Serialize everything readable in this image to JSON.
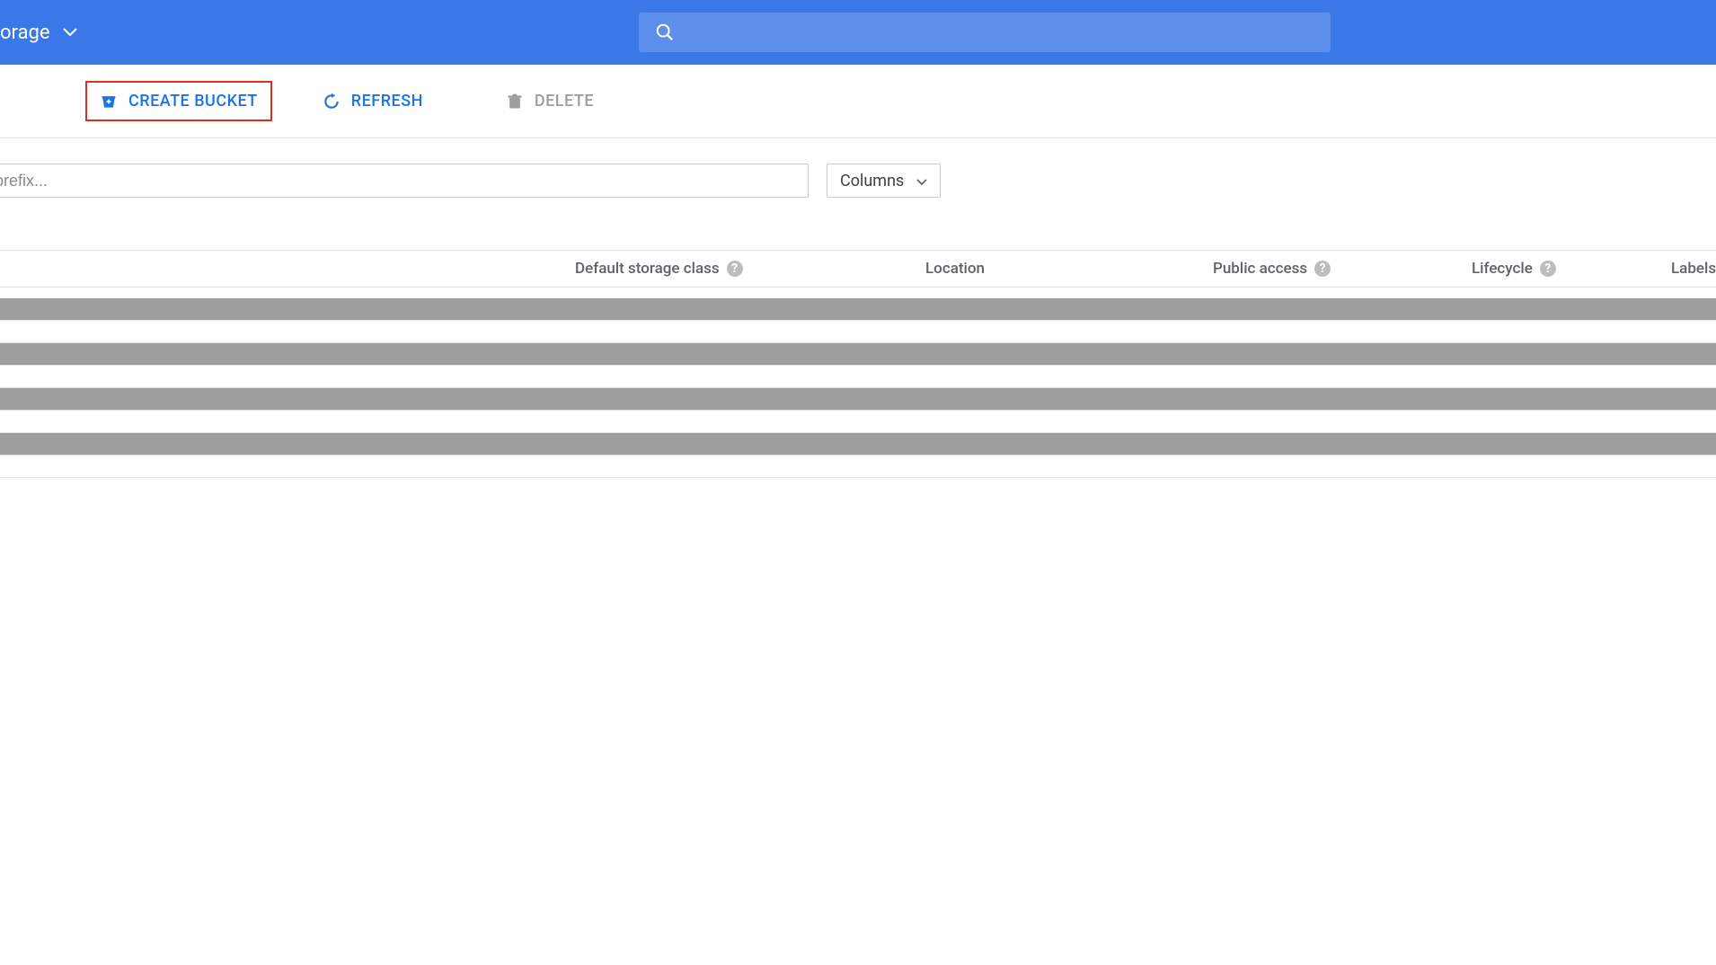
{
  "header": {
    "product_label_suffix": "orage",
    "search_placeholder": ""
  },
  "toolbar": {
    "create_bucket_label": "CREATE BUCKET",
    "refresh_label": "REFRESH",
    "delete_label": "DELETE"
  },
  "filter": {
    "prefix_placeholder": "orefix...",
    "columns_label": "Columns"
  },
  "table": {
    "headers": {
      "default_storage_class": "Default storage class",
      "location": "Location",
      "public_access": "Public access",
      "lifecycle": "Lifecycle",
      "labels": "Labels"
    },
    "redacted_row_count": 4
  },
  "colors": {
    "header_bg": "#3b78e7",
    "primary_action": "#1a73e8",
    "highlight_border": "#d93025",
    "disabled": "#9e9e9e"
  },
  "icons": {
    "search": "search-icon",
    "bucket_add": "bucket-add-icon",
    "refresh": "refresh-icon",
    "delete": "trash-icon",
    "dropdown": "chevron-down-icon",
    "help": "help-icon"
  }
}
